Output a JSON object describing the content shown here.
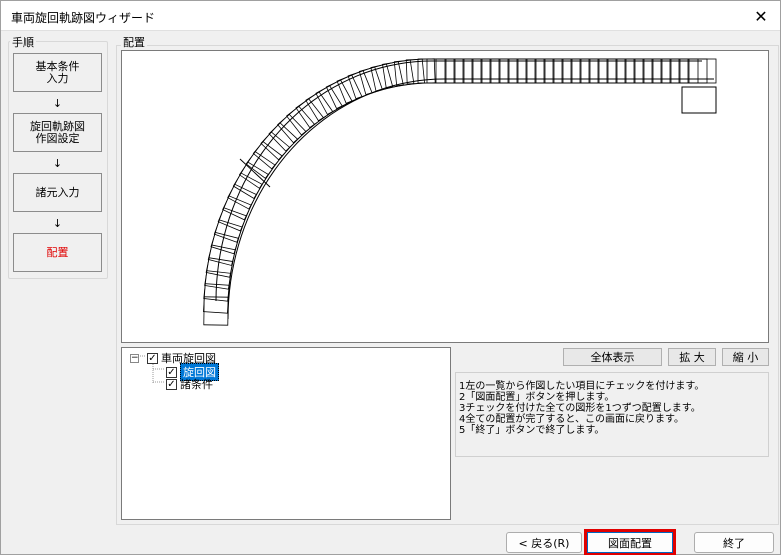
{
  "window": {
    "title": "車両旋回軌跡図ウィザード",
    "close_glyph": "✕"
  },
  "steps": {
    "label": "手順",
    "items": [
      {
        "line1": "基本条件",
        "line2": "入力"
      },
      {
        "line1": "旋回軌跡図",
        "line2": "作図設定"
      },
      {
        "line1": "諸元入力",
        "line2": ""
      },
      {
        "line1": "配置",
        "line2": ""
      }
    ],
    "arrow": "↓",
    "active_color": "#e00000"
  },
  "main": {
    "label": "配置"
  },
  "tree": {
    "root": {
      "label": "車両旋回図",
      "checked": true
    },
    "children": [
      {
        "label": "旋回図",
        "checked": true,
        "selected": true
      },
      {
        "label": "諸条件",
        "checked": true,
        "selected": false
      }
    ],
    "check_glyph": "✓",
    "expander_glyph": "−"
  },
  "toolbar": {
    "show_all": "全体表示",
    "zoom_in": "拡 大",
    "zoom_out": "縮 小"
  },
  "instructions": [
    "1左の一覧から作図したい項目にチェックを付けます。",
    "2「図面配置」ボタンを押します。",
    "3チェックを付けた全ての図形を1つずつ配置します。",
    "4全ての配置が完了すると、この画面に戻ります。",
    "5「終了」ボタンで終了します。"
  ],
  "buttons": {
    "back": "< 戻る(R)",
    "place": "図面配置",
    "finish": "終了"
  },
  "colors": {
    "highlight": "#e00000",
    "selection": "#0078d7"
  }
}
